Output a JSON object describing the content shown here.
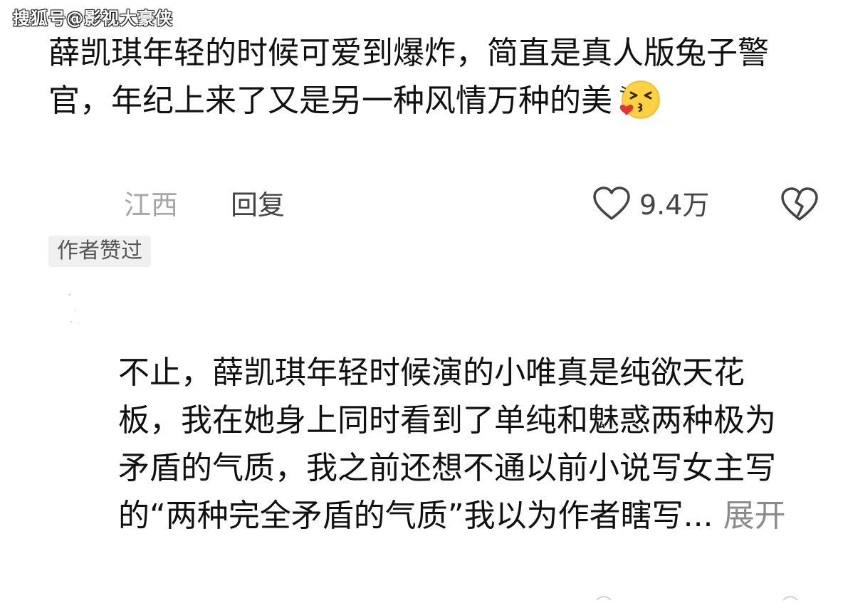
{
  "watermark": "搜狐号@影视大豪侠",
  "comment": {
    "text": "薛凯琪年轻的时候可爱到爆炸，简直是真人版兔子警官，年纪上来了又是另一种风情万种的美",
    "emoji": "kissing-heart-emoji",
    "location": "江西",
    "reply_label": "回复",
    "like_icon": "heart-outline-icon",
    "like_count": "9.4万",
    "dislike_icon": "broken-heart-icon",
    "author_badge": "作者赞过"
  },
  "reply": {
    "text": "不止，薛凯琪年轻时候演的小唯真是纯欲天花板，我在她身上同时看到了单纯和魅惑两种极为矛盾的气质，我之前还想不通以前小说写女主写的“两种完全矛盾的气质”我以为作者瞎写...",
    "expand_label": "展开"
  },
  "colors": {
    "text": "#111111",
    "muted": "#a6a6a6",
    "secondary": "#444444",
    "badge_bg": "#f0f0f0",
    "emoji_face": "#ffd23f",
    "emoji_heart": "#e8313a"
  }
}
